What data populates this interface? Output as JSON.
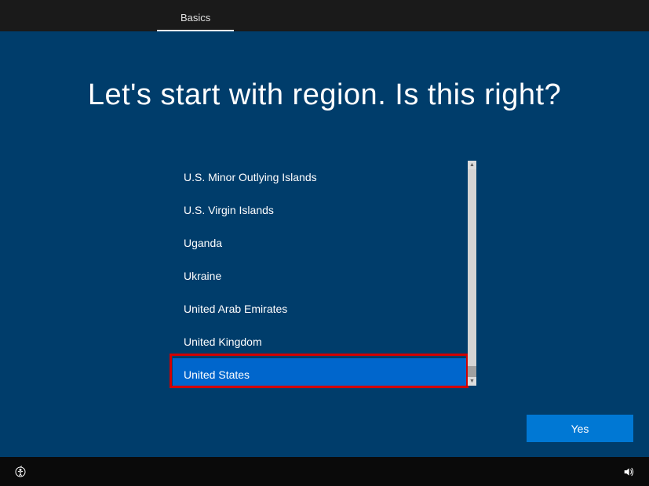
{
  "header": {
    "tab_label": "Basics"
  },
  "main": {
    "title": "Let's start with region. Is this right?",
    "regions": [
      "U.S. Minor Outlying Islands",
      "U.S. Virgin Islands",
      "Uganda",
      "Ukraine",
      "United Arab Emirates",
      "United Kingdom",
      "United States"
    ],
    "selected_index": 6,
    "yes_button": "Yes"
  },
  "colors": {
    "background": "#003d6b",
    "accent": "#0078d4",
    "selected": "#0066cc",
    "highlight_border": "#d10000"
  }
}
